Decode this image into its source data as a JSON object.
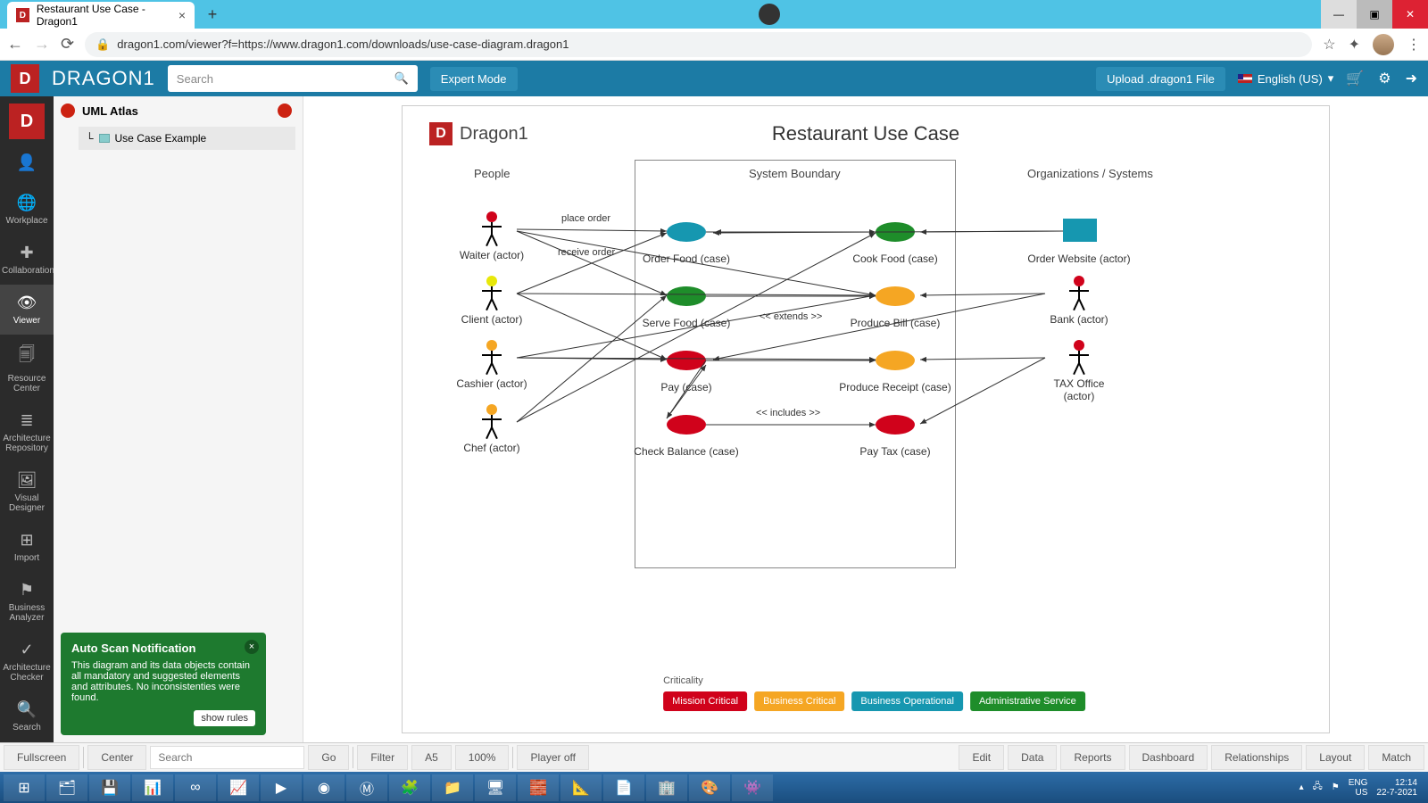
{
  "browser": {
    "tab_title": "Restaurant Use Case - Dragon1",
    "url": "dragon1.com/viewer?f=https://www.dragon1.com/downloads/use-case-diagram.dragon1"
  },
  "header": {
    "brand": "DRAGON1",
    "search_placeholder": "Search",
    "expert": "Expert Mode",
    "upload": "Upload .dragon1 File",
    "language": "English (US)"
  },
  "leftnav": [
    {
      "label": "",
      "icon": "▣"
    },
    {
      "label": "Workplace",
      "icon": "⌂"
    },
    {
      "label": "Collaboration",
      "icon": "✚"
    },
    {
      "label": "Viewer",
      "icon": "👤",
      "active": true
    },
    {
      "label": "Resource Center",
      "icon": "🗐"
    },
    {
      "label": "Architecture Repository",
      "icon": "≡"
    },
    {
      "label": "Visual Designer",
      "icon": "▦"
    },
    {
      "label": "Import",
      "icon": "⊞"
    },
    {
      "label": "Business Analyzer",
      "icon": "⚑"
    },
    {
      "label": "Architecture Checker",
      "icon": "✓"
    },
    {
      "label": "Search",
      "icon": "🔍"
    }
  ],
  "tree": {
    "root": "UML Atlas",
    "item": "Use Case Example"
  },
  "notification": {
    "title": "Auto Scan Notification",
    "body": "This diagram and its data objects contain all mandatory and suggested elements and attributes. No inconsistenties were found.",
    "button": "show rules"
  },
  "diagram": {
    "logo_text": "Dragon1",
    "title": "Restaurant Use Case",
    "columns": {
      "people": "People",
      "boundary": "System Boundary",
      "orgs": "Organizations / Systems"
    },
    "actors": {
      "waiter": "Waiter (actor)",
      "client": "Client (actor)",
      "cashier": "Cashier (actor)",
      "chef": "Chef (actor)",
      "website": "Order Website (actor)",
      "bank": "Bank (actor)",
      "tax": "TAX Office (actor)"
    },
    "cases": {
      "order": "Order Food (case)",
      "cook": "Cook Food (case)",
      "serve": "Serve Food (case)",
      "bill": "Produce Bill (case)",
      "pay": "Pay (case)",
      "receipt": "Produce Receipt (case)",
      "balance": "Check Balance (case)",
      "tax": "Pay Tax (case)"
    },
    "edges": {
      "place": "place order",
      "receive": "receive order",
      "extends": "<< extends >>",
      "includes": "<< includes >>"
    },
    "criticality_label": "Criticality",
    "legend": [
      "Mission Critical",
      "Business Critical",
      "Business Operational",
      "Administrative Service"
    ]
  },
  "bottombar": {
    "fullscreen": "Fullscreen",
    "center": "Center",
    "search_ph": "Search",
    "go": "Go",
    "filter": "Filter",
    "a5": "A5",
    "zoom": "100%",
    "player": "Player off",
    "edit": "Edit",
    "data": "Data",
    "reports": "Reports",
    "dashboard": "Dashboard",
    "relationships": "Relationships",
    "layout": "Layout",
    "match": "Match"
  },
  "tray": {
    "lang1": "ENG",
    "lang2": "US",
    "time": "12:14",
    "date": "22-7-2021"
  },
  "colors": {
    "teal": "#1697b0",
    "green": "#1e8d2a",
    "orange": "#f5a623",
    "red": "#d0021b",
    "yellow": "#e8e80a"
  }
}
